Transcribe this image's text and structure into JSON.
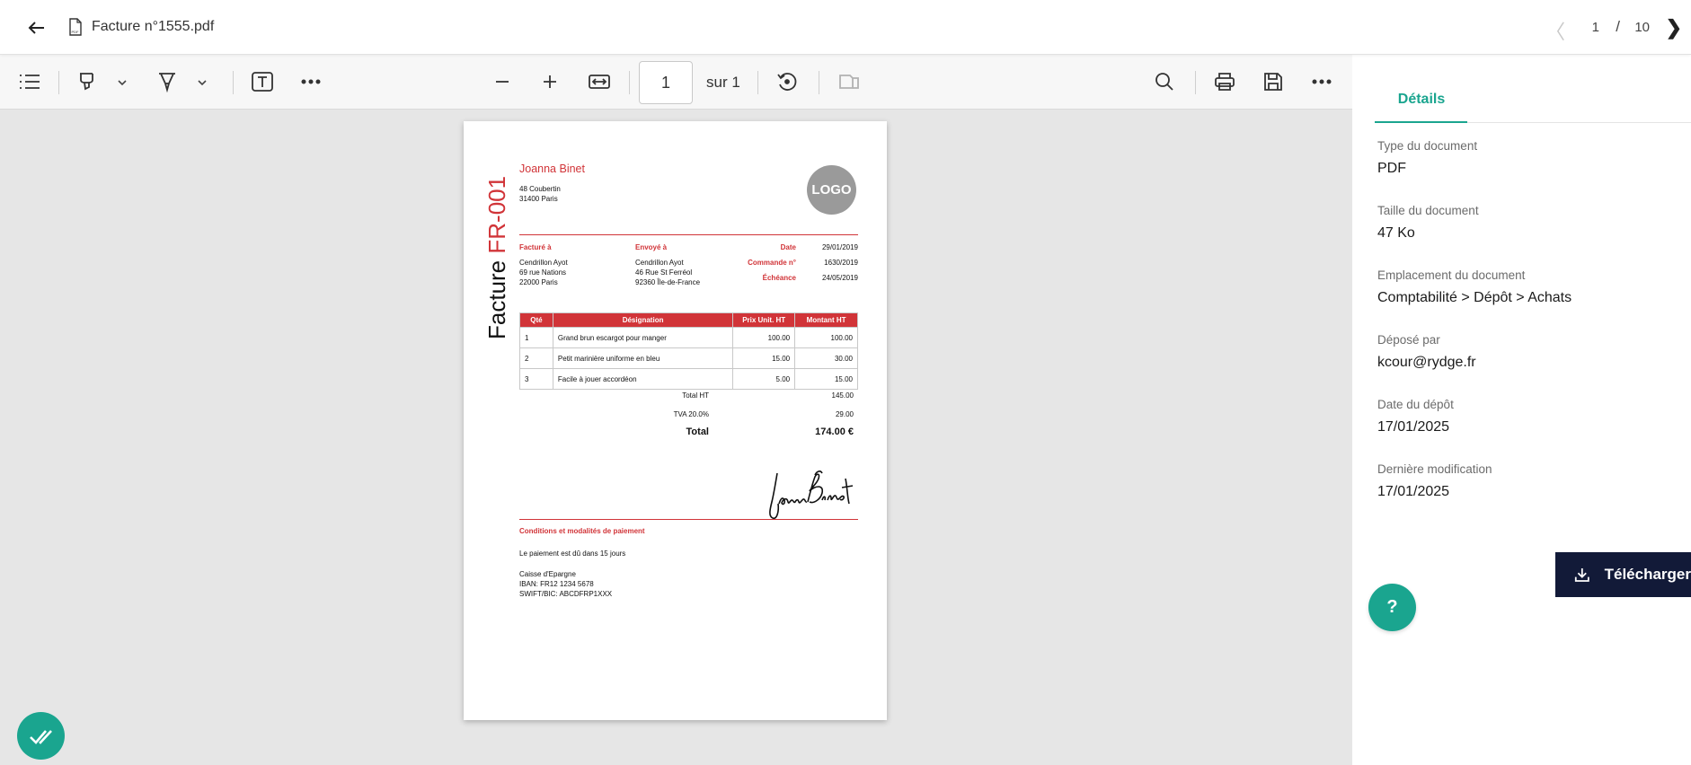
{
  "header": {
    "file_name": "Facture n°1555.pdf",
    "pager": {
      "prev": "〈",
      "current": "1",
      "separator": "/",
      "total": "10",
      "next": "❯"
    }
  },
  "toolbar": {
    "page_value": "1",
    "page_of": "sur 1"
  },
  "document": {
    "title_word": "Facture",
    "title_number": "FR-001",
    "sender": {
      "name": "Joanna Binet",
      "addr1": "48 Coubertin",
      "addr2": "31400 Paris"
    },
    "logo": "LOGO",
    "billed_to": {
      "label": "Facturé à",
      "name": "Cendrillon Ayot",
      "addr1": "69 rue Nations",
      "addr2": "22000 Paris"
    },
    "shipped_to": {
      "label": "Envoyé à",
      "name": "Cendrillon Ayot",
      "addr1": "46 Rue St Ferréol",
      "addr2": "92360 Île-de-France"
    },
    "meta": [
      {
        "label": "Date",
        "value": "29/01/2019"
      },
      {
        "label": "Commande n°",
        "value": "1630/2019"
      },
      {
        "label": "Échéance",
        "value": "24/05/2019"
      }
    ],
    "table": {
      "headers": [
        "Qté",
        "Désignation",
        "Prix Unit. HT",
        "Montant HT"
      ],
      "rows": [
        [
          "1",
          "Grand brun escargot pour manger",
          "100.00",
          "100.00"
        ],
        [
          "2",
          "Petit marinière uniforme en bleu",
          "15.00",
          "30.00"
        ],
        [
          "3",
          "Facile à jouer accordéon",
          "5.00",
          "15.00"
        ]
      ]
    },
    "totals": {
      "ht_label": "Total HT",
      "ht_value": "145.00",
      "tva_label": "TVA 20.0%",
      "tva_value": "29.00",
      "total_label": "Total",
      "total_value": "174.00 €"
    },
    "conditions": {
      "title": "Conditions et modalités de paiement",
      "line1": "Le paiement est dû dans 15 jours",
      "bank": "Caisse d'Epargne",
      "iban": "IBAN: FR12 1234 5678",
      "swift": "SWIFT/BIC: ABCDFRP1XXX"
    }
  },
  "sidebar": {
    "tab": "Détails",
    "fields": [
      {
        "label": "Type du document",
        "value": "PDF"
      },
      {
        "label": "Taille du document",
        "value": "47 Ko"
      },
      {
        "label": "Emplacement du document",
        "value": "Comptabilité > Dépôt > Achats"
      },
      {
        "label": "Déposé par",
        "value": "kcour@rydge.fr"
      },
      {
        "label": "Date du dépôt",
        "value": "17/01/2025"
      },
      {
        "label": "Dernière modification",
        "value": "17/01/2025"
      }
    ],
    "download_label": "Télécharger"
  },
  "help_label": "?",
  "colors": {
    "accent": "#1aa58f",
    "invoice_red": "#d13438",
    "dark_button": "#121a38"
  }
}
